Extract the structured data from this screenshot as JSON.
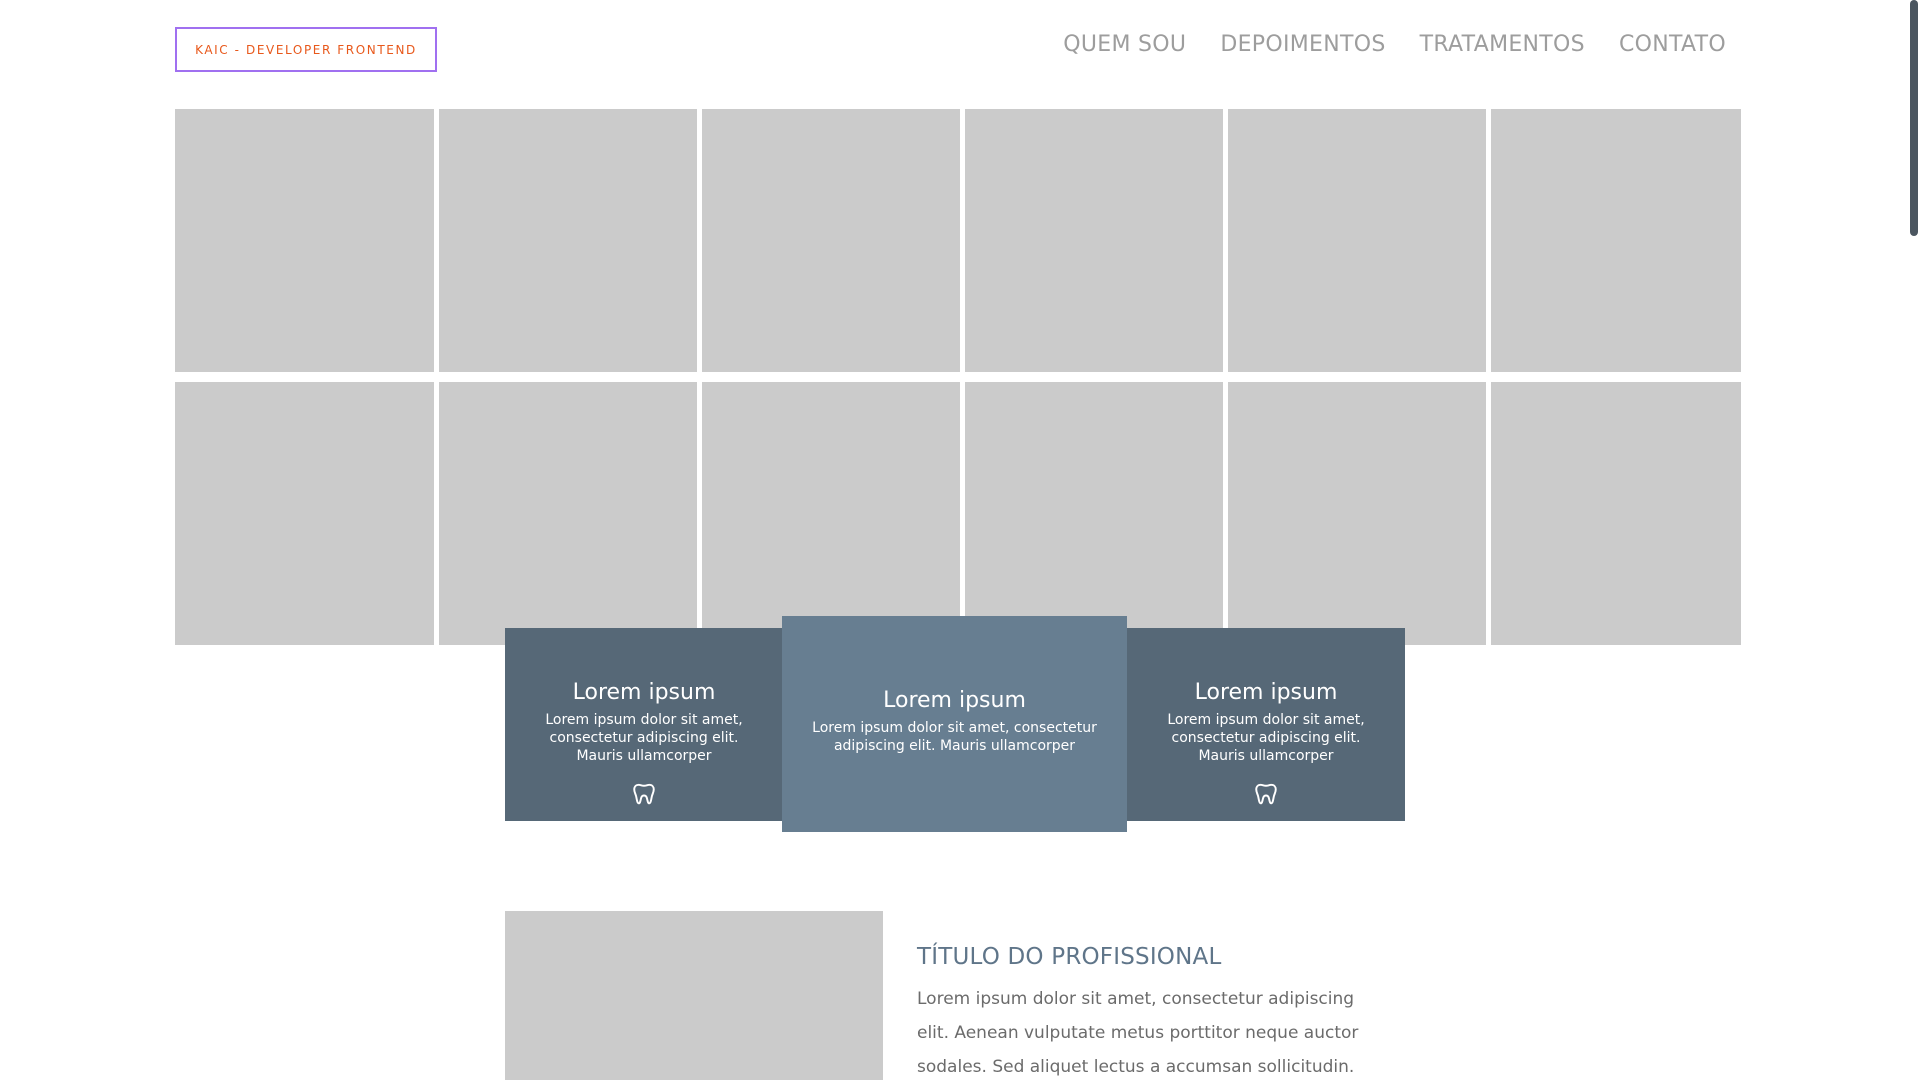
{
  "header": {
    "logo_text": "KAIC - DEVELOPER FRONTEND",
    "nav": [
      {
        "label": "QUEM SOU"
      },
      {
        "label": "DEPOIMENTOS"
      },
      {
        "label": "TRATAMENTOS"
      },
      {
        "label": "CONTATO"
      }
    ]
  },
  "gallery": {
    "tile_count": 12
  },
  "cards": [
    {
      "title": "Lorem ipsum",
      "text": "Lorem ipsum dolor sit amet, consectetur adipiscing elit. Mauris ullamcorper",
      "icon": "tooth-icon"
    },
    {
      "title": "Lorem ipsum",
      "text": "Lorem ipsum dolor sit amet, consectetur adipiscing elit. Mauris ullamcorper"
    },
    {
      "title": "Lorem ipsum",
      "text": "Lorem ipsum dolor sit amet, consectetur adipiscing elit. Mauris ullamcorper",
      "icon": "tooth-icon"
    }
  ],
  "professional": {
    "title": "TÍTULO DO PROFISSIONAL",
    "text": "Lorem ipsum dolor sit amet, consectetur adipiscing elit. Aenean vulputate metus porttitor neque auctor sodales. Sed aliquet lectus a accumsan sollicitudin."
  },
  "colors": {
    "logo_border": "#a070f0",
    "logo_text": "#e8581b",
    "card_side": "#566877",
    "card_center": "#677e91",
    "title_accent": "#5f7589"
  }
}
